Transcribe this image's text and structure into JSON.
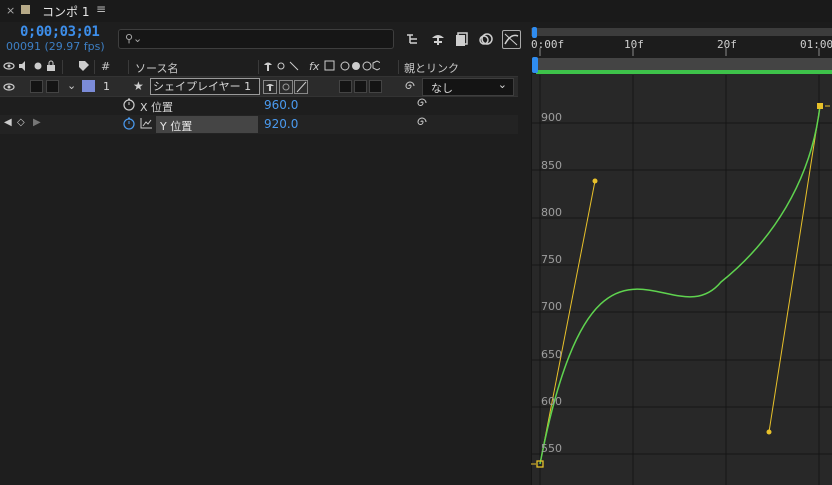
{
  "tab": {
    "close": "×",
    "title": "コンポ 1",
    "menu": "≡",
    "swatch_color": "#b7aa88"
  },
  "timecode": "0;00;03;01",
  "frame_info": "00091 (29.97 fps)",
  "search": {
    "placeholder": "",
    "icon": "search-icon"
  },
  "toolbar_icons": [
    "composition-flowchart-icon",
    "draft-3d-icon",
    "frame-blending-icon",
    "motion-blur-icon",
    "graph-editor-icon"
  ],
  "columns": {
    "number": "#",
    "source_name": "ソース名",
    "switches": "fx",
    "parent": "親とリンク"
  },
  "layer": {
    "number": "1",
    "name": "シェイプレイヤー 1",
    "color": "#7b8bd8",
    "parent": "なし"
  },
  "properties": [
    {
      "name": "X 位置",
      "value": "960.0"
    },
    {
      "name": "Y 位置",
      "value": "920.0"
    }
  ],
  "ruler": {
    "labels": [
      "0:00f",
      "10f",
      "20f",
      "01:00"
    ]
  },
  "graph": {
    "y_labels": [
      "900",
      "850",
      "800",
      "750",
      "700",
      "650",
      "600",
      "550"
    ],
    "curve_color": "#5fd34f",
    "handle_color": "#e8c12a",
    "work_area_color": "#3ec24a",
    "playhead_color": "#2f8cf0"
  }
}
